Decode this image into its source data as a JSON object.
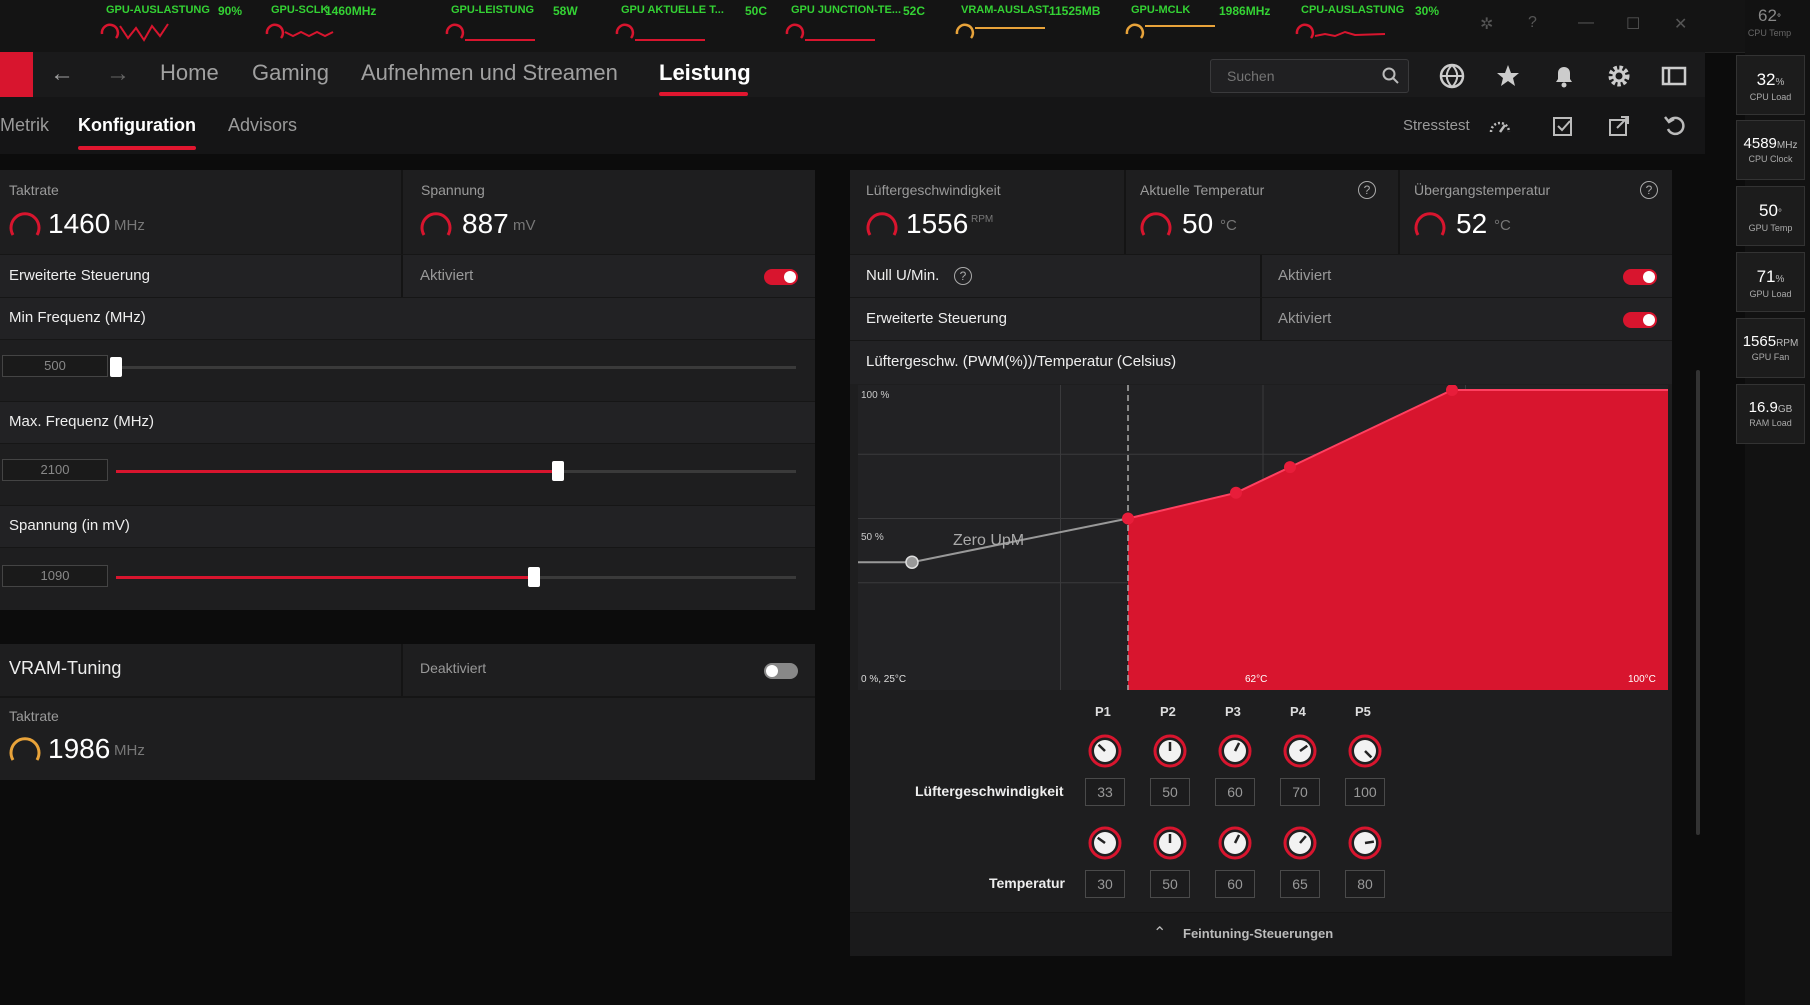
{
  "metrics_bar": [
    {
      "label": "GPU-AUSLASTUNG",
      "value": "90%",
      "color": "#d8152e"
    },
    {
      "label": "GPU-SCLK",
      "value": "1460MHz",
      "color": "#d8152e"
    },
    {
      "label": "GPU-LEISTUNG",
      "value": "58W",
      "color": "#d8152e"
    },
    {
      "label": "GPU AKTUELLE T...",
      "value": "50C",
      "color": "#d8152e"
    },
    {
      "label": "GPU JUNCTION-TE...",
      "value": "52C",
      "color": "#d8152e"
    },
    {
      "label": "VRAM-AUSLAST.",
      "value": "11525MB",
      "color": "#e8a33a"
    },
    {
      "label": "GPU-MCLK",
      "value": "1986MHz",
      "color": "#e8a33a"
    },
    {
      "label": "CPU-AUSLASTUNG",
      "value": "30%",
      "color": "#d8152e"
    }
  ],
  "nav": {
    "links": [
      "Home",
      "Gaming",
      "Aufnehmen und Streamen",
      "Leistung"
    ],
    "active": "Leistung",
    "search_placeholder": "Suchen"
  },
  "subnav": {
    "tabs": [
      "Metrik",
      "Konfiguration",
      "Advisors"
    ],
    "active": "Konfiguration",
    "stresstest_label": "Stresstest"
  },
  "gpu_tuning": {
    "taktrate_label": "Taktrate",
    "taktrate_value": "1460",
    "taktrate_unit": "MHz",
    "spannung_label": "Spannung",
    "spannung_value": "887",
    "spannung_unit": "mV",
    "erweitert_label": "Erweiterte Steuerung",
    "erweitert_status": "Aktiviert",
    "min_freq_label": "Min Frequenz (MHz)",
    "min_freq_value": "500",
    "min_freq_fraction": 0.0,
    "max_freq_label": "Max. Frequenz (MHz)",
    "max_freq_value": "2100",
    "max_freq_fraction": 0.65,
    "spannung_mv_label": "Spannung (in mV)",
    "spannung_mv_value": "1090",
    "spannung_mv_fraction": 0.615
  },
  "vram": {
    "label": "VRAM-Tuning",
    "status": "Deaktiviert",
    "taktrate_label": "Taktrate",
    "taktrate_value": "1986",
    "taktrate_unit": "MHz"
  },
  "fan": {
    "speed_label": "Lüftergeschwindigkeit",
    "speed_value": "1556",
    "speed_unit": "RPM",
    "temp_label": "Aktuelle Temperatur",
    "temp_value": "50",
    "temp_unit": "°C",
    "junction_label": "Übergangstemperatur",
    "junction_value": "52",
    "junction_unit": "°C",
    "zero_rpm_label": "Null U/Min.",
    "zero_rpm_status": "Aktiviert",
    "advanced_label": "Erweiterte Steuerung",
    "advanced_status": "Aktiviert",
    "curve_title": "Lüftergeschw. (PWM(%))/Temperatur (Celsius)",
    "zero_upm_label": "Zero UpM",
    "y_top_label": "100 %",
    "y_mid_label": "50 %",
    "origin_label": "0 %, 25°C",
    "x_mid_label": "62°C",
    "x_max_label": "100°C",
    "points": [
      "P1",
      "P2",
      "P3",
      "P4",
      "P5"
    ],
    "speed_row_label": "Lüftergeschwindigkeit",
    "speeds": [
      "33",
      "50",
      "60",
      "70",
      "100"
    ],
    "temp_row_label": "Temperatur",
    "temps": [
      "30",
      "50",
      "60",
      "65",
      "80"
    ],
    "fine_tuning_label": "Feintuning-Steuerungen"
  },
  "chart_data": {
    "type": "area",
    "title": "Lüftergeschw. (PWM(%))/Temperatur (Celsius)",
    "xlim": [
      25,
      100
    ],
    "ylim": [
      0,
      100
    ],
    "zero_rpm_points": [
      {
        "x": 30,
        "y": 33
      },
      {
        "x": 50,
        "y": 50
      }
    ],
    "series": [
      {
        "x": [
          50,
          60,
          65,
          80,
          100
        ],
        "y": [
          50,
          60,
          70,
          100,
          100
        ]
      }
    ]
  },
  "side_rail": [
    {
      "value": "62",
      "unit": "°",
      "label": "CPU Temp"
    },
    {
      "value": "32",
      "unit": "%",
      "label": "CPU Load"
    },
    {
      "value": "4589",
      "unit": "MHz",
      "label": "CPU Clock"
    },
    {
      "value": "50",
      "unit": "°",
      "label": "GPU Temp"
    },
    {
      "value": "71",
      "unit": "%",
      "label": "GPU Load"
    },
    {
      "value": "1565",
      "unit": "RPM",
      "label": "GPU Fan"
    },
    {
      "value": "16.9",
      "unit": "GB",
      "label": "RAM Load"
    }
  ],
  "colors": {
    "accent": "#d8152e",
    "vram_accent": "#e8a33a",
    "metric_text": "#34d234"
  }
}
